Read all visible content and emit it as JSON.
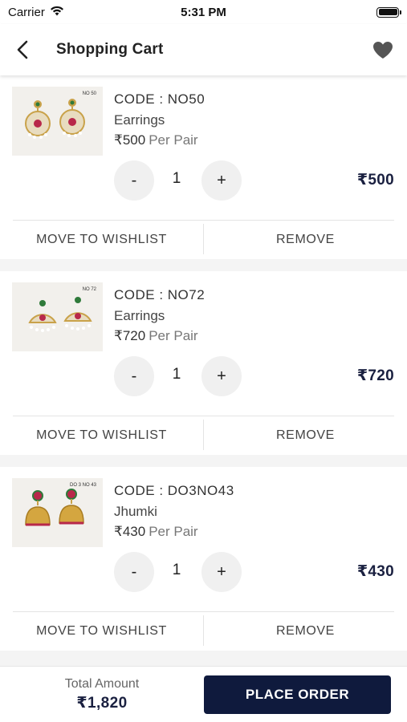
{
  "status_bar": {
    "carrier": "Carrier",
    "time": "5:31 PM",
    "wifi_icon": "wifi-icon",
    "battery_icon": "battery-icon"
  },
  "header": {
    "title": "Shopping Cart",
    "back_icon": "chevron-left-icon",
    "wishlist_icon": "heart-icon"
  },
  "colors": {
    "accent": "#0f1a3d",
    "price": "#1a2040",
    "background": "#f4f4f4"
  },
  "cart": {
    "items": [
      {
        "thumb_code": "NO 50",
        "code": "CODE : NO50",
        "name": "Earrings",
        "price": "₹500",
        "unit": "Per Pair",
        "quantity": "1",
        "minus": "-",
        "plus": "+",
        "line_total": "₹500",
        "wishlist_label": "MOVE TO WISHLIST",
        "remove_label": "REMOVE"
      },
      {
        "thumb_code": "NO 72",
        "code": "CODE : NO72",
        "name": "Earrings",
        "price": "₹720",
        "unit": "Per Pair",
        "quantity": "1",
        "minus": "-",
        "plus": "+",
        "line_total": "₹720",
        "wishlist_label": "MOVE TO WISHLIST",
        "remove_label": "REMOVE"
      },
      {
        "thumb_code": "DO 3 NO 43",
        "code": "CODE : DO3NO43",
        "name": "Jhumki",
        "price": "₹430",
        "unit": "Per Pair",
        "quantity": "1",
        "minus": "-",
        "plus": "+",
        "line_total": "₹430",
        "wishlist_label": "MOVE TO WISHLIST",
        "remove_label": "REMOVE"
      }
    ]
  },
  "footer": {
    "total_label": "Total Amount",
    "total_value": "₹1,820",
    "place_order_label": "PLACE ORDER"
  }
}
